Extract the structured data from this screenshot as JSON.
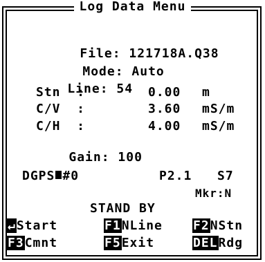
{
  "title": "Log Data Menu",
  "file": {
    "label": "File:",
    "value": "121718A.Q38"
  },
  "mode": {
    "label": "Mode:",
    "value": "Auto"
  },
  "line": {
    "label": "Line:",
    "value": "54"
  },
  "readings": [
    {
      "label": "Stn  :",
      "value": "0.00",
      "unit": "m"
    },
    {
      "label": "C/V  :",
      "value": "3.60",
      "unit": "mS/m"
    },
    {
      "label": "C/H  :",
      "value": "4.00",
      "unit": "mS/m"
    }
  ],
  "gain": {
    "label": "Gain:",
    "value": "100"
  },
  "dgps": {
    "label": "DGPS",
    "value": "#0"
  },
  "p_value": "P2.1",
  "s_value": "S7",
  "marker": "Mkr:N",
  "status": "STAND BY",
  "softkeys": [
    {
      "key": "↵",
      "label": "Start"
    },
    {
      "key": "F1",
      "label": "NLine"
    },
    {
      "key": "F2",
      "label": "NStn"
    },
    {
      "key": "F3",
      "label": "Cmnt"
    },
    {
      "key": "F5",
      "label": "Exit"
    },
    {
      "key": "DEL",
      "label": "Rdg"
    }
  ]
}
